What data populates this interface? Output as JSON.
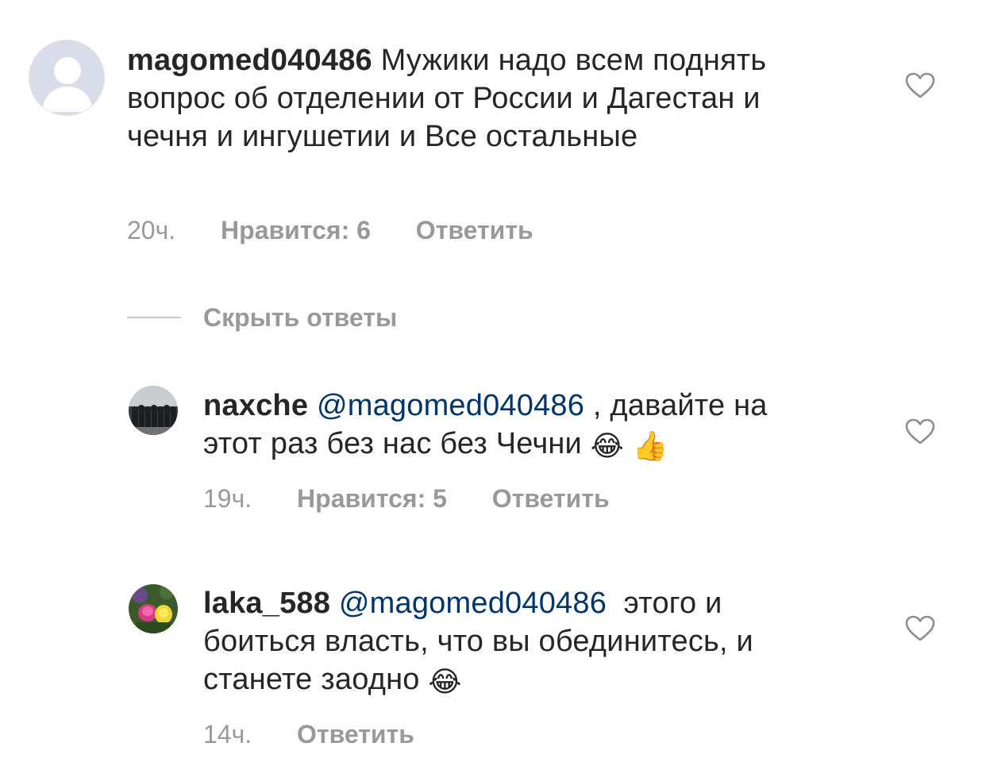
{
  "comments": [
    {
      "username": "magomed040486",
      "text": "Мужики надо всем поднять вопрос об отделении от России и Дагестан и чечня и ингушетии и Все остальные",
      "time": "20ч.",
      "likes": "Нравится: 6",
      "reply": "Ответить"
    }
  ],
  "hide_replies_label": "Скрыть ответы",
  "replies": [
    {
      "username": "naxche",
      "mention": "@magomed040486",
      "text_part1": " , давайте на",
      "text_part2": "этот раз без нас без Чечни ",
      "emoji1": "😂",
      "emoji2": "👍",
      "time": "19ч.",
      "likes": "Нравится: 5",
      "reply": "Ответить"
    },
    {
      "username": "laka_588",
      "mention": "@magomed040486",
      "text_part1": "  этого и",
      "text_part2": "боиться власть, что вы обединитесь, и",
      "text_part3": "станете заодно ",
      "emoji1": "😂",
      "time": "14ч.",
      "reply": "Ответить"
    }
  ],
  "colors": {
    "text": "#262626",
    "mention": "#003569",
    "meta": "#999999",
    "heart_stroke": "#8e8e8e"
  },
  "icons": {
    "like": "heart-outline-icon",
    "default_avatar": "person-silhouette-icon"
  }
}
